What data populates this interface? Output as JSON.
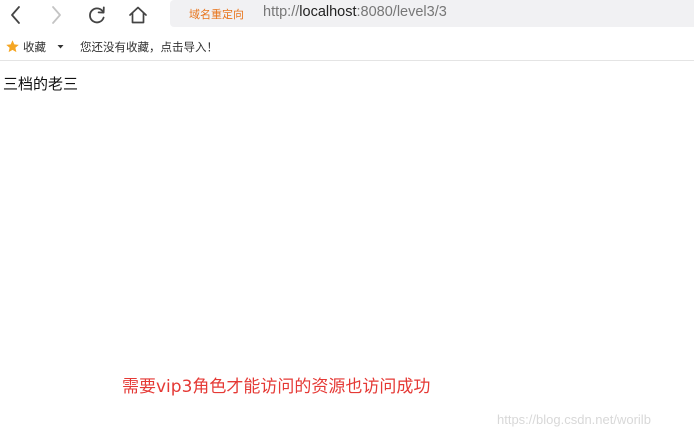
{
  "navbar": {
    "back_icon": "chevron-left-icon",
    "forward_icon": "chevron-right-icon",
    "reload_icon": "reload-icon",
    "home_icon": "home-icon",
    "redirect_tag": "域名重定向",
    "url": {
      "scheme": "http://",
      "host": "localhost",
      "rest": ":8080/level3/3"
    }
  },
  "bookmarks": {
    "star_icon": "star-icon",
    "label": "收藏",
    "caret_icon": "caret-down-icon",
    "hint": "您还没有收藏，点击导入！"
  },
  "content": {
    "text": "三档的老三"
  },
  "annotation": {
    "text": "需要vip3角色才能访问的资源也访问成功"
  },
  "watermark": {
    "text": "https://blog.csdn.net/worilb"
  },
  "colors": {
    "redirect_tag": "#e8741b",
    "annotation": "#e53935",
    "star": "#f5a623",
    "urlbar_bg": "#f1f1f3"
  }
}
